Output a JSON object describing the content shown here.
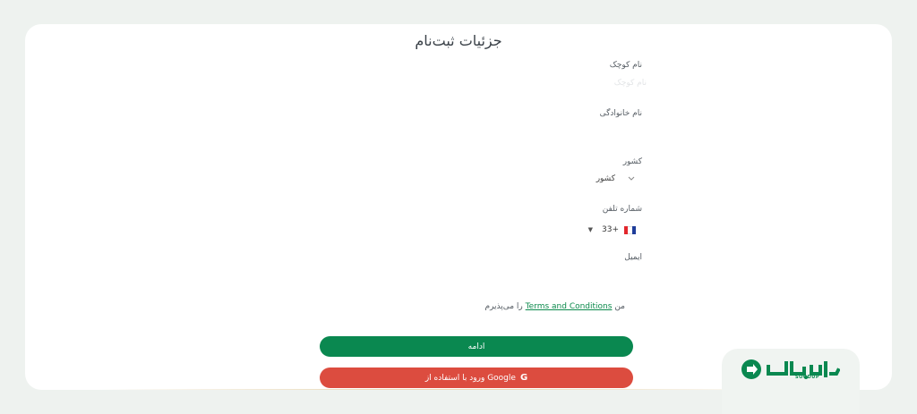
{
  "form": {
    "title": "جزئیات ثبت‌نام",
    "first_name_label": "نام کوچک",
    "first_name_placeholder": "نام کوچک",
    "last_name_label": "نام خانوادگی",
    "last_name_placeholder": "",
    "country_label": "کشور",
    "country_value": "کشور",
    "phone_label": "شماره تلفن",
    "phone_code": "+33",
    "phone_placeholder": "",
    "email_label": "ایمیل",
    "email_placeholder": "",
    "terms_prefix": "من",
    "terms_link": "Terms and Conditions",
    "terms_suffix": "را می‌پذیرم",
    "continue_button": "ادامه",
    "google_button": "ورود با استفاده از Google",
    "google_icon_glyph": "G"
  },
  "brand": {
    "logo_text": "SOODUP",
    "color": "#0a8850"
  },
  "colors": {
    "primary": "#0a8850",
    "google": "#dc4c3f",
    "link": "#0c8a4c"
  }
}
